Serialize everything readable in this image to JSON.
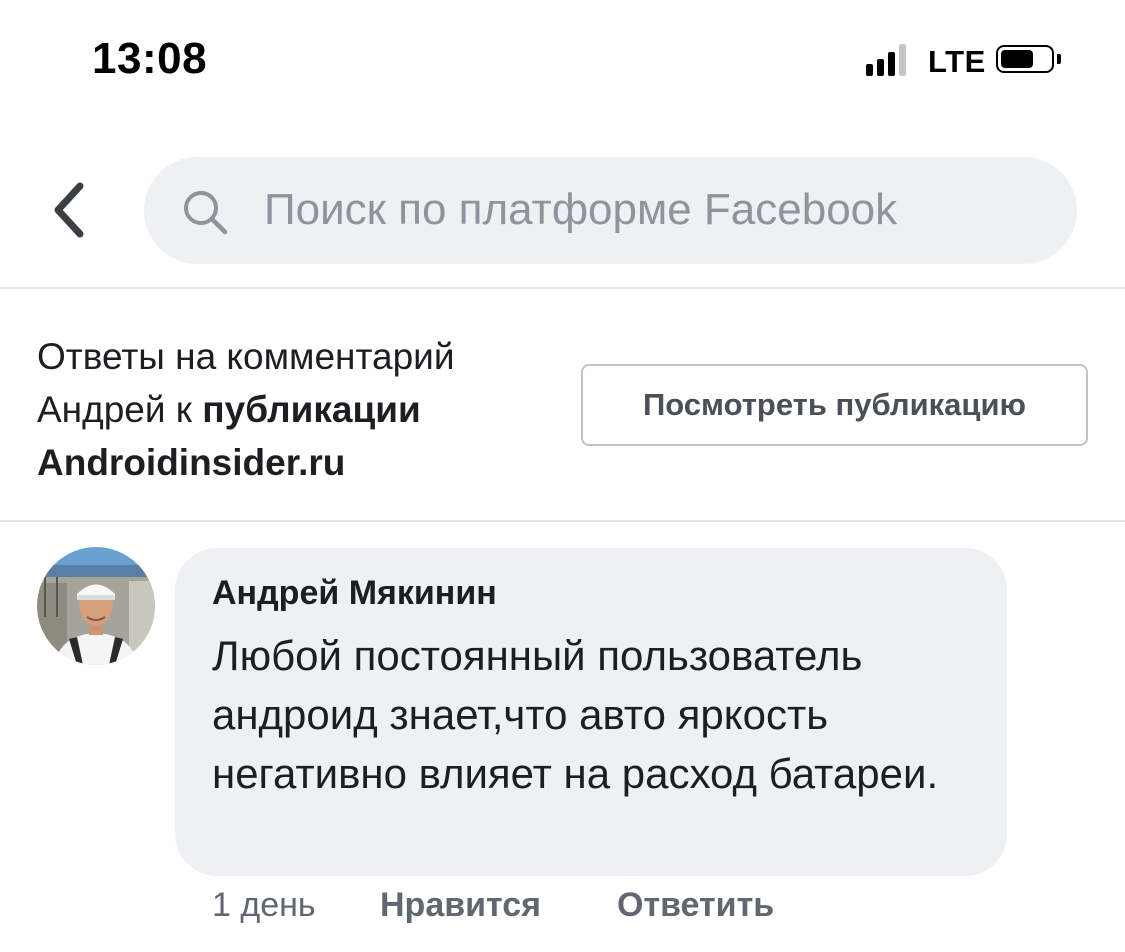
{
  "status_bar": {
    "time": "13:08",
    "network": "LTE",
    "icons": [
      "signal-icon",
      "battery-icon"
    ]
  },
  "search": {
    "placeholder": "Поиск по платформе Facebook",
    "value": "",
    "icons": [
      "back-chevron-icon",
      "search-icon"
    ]
  },
  "context": {
    "prefix": "Ответы на комментарий Андрей к ",
    "bold_link": "публикации Androidinsider.ru",
    "view_post_label": "Посмотреть публикацию"
  },
  "comment": {
    "author": "Андрей Мякинин",
    "text": "Любой постоянный пользователь андроид знает,что авто яркость негативно влияет на расход батареи.",
    "time": "1 день",
    "like_label": "Нравится",
    "reply_label": "Ответить"
  },
  "colors": {
    "bubble_background": "#eef0f3",
    "secondary_text": "#606770",
    "placeholder_text": "#8d949e"
  }
}
